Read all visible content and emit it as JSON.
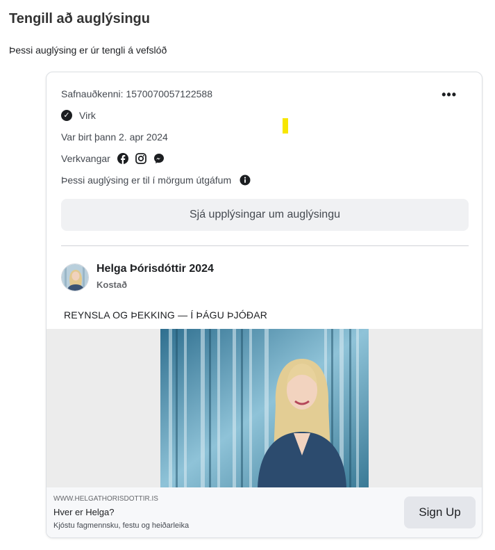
{
  "header": {
    "title": "Tengill að auglýsingu",
    "subtitle": "Þessi auglýsing er úr tengli á vefslóð"
  },
  "ad_meta": {
    "library_id": "Safnauðkenni: 1570070057122588",
    "status": "Virk",
    "published": "Var birt þann 2. apr 2024",
    "platforms_label": "Verkvangar",
    "platforms": [
      "facebook-icon",
      "instagram-icon",
      "messenger-icon"
    ],
    "versions_note": "Þessi auglýsing er til í mörgum útgáfum",
    "more_menu": "•••",
    "details_button": "Sjá upplýsingar um auglýsingu"
  },
  "post": {
    "author": "Helga Þórisdóttir 2024",
    "sponsored": "Kostað",
    "text": "REYNSLA OG ÞEKKING — Í ÞÁGU ÞJÓÐAR"
  },
  "link_footer": {
    "url": "WWW.HELGATHORISDOTTIR.IS",
    "title": "Hver er Helga?",
    "description": "Kjóstu fagmennsku, festu og heiðarleika",
    "cta": "Sign Up"
  },
  "colors": {
    "accent_marker": "#f7e600",
    "button_bg": "#f0f1f3",
    "cta_bg": "#e4e6eb"
  }
}
